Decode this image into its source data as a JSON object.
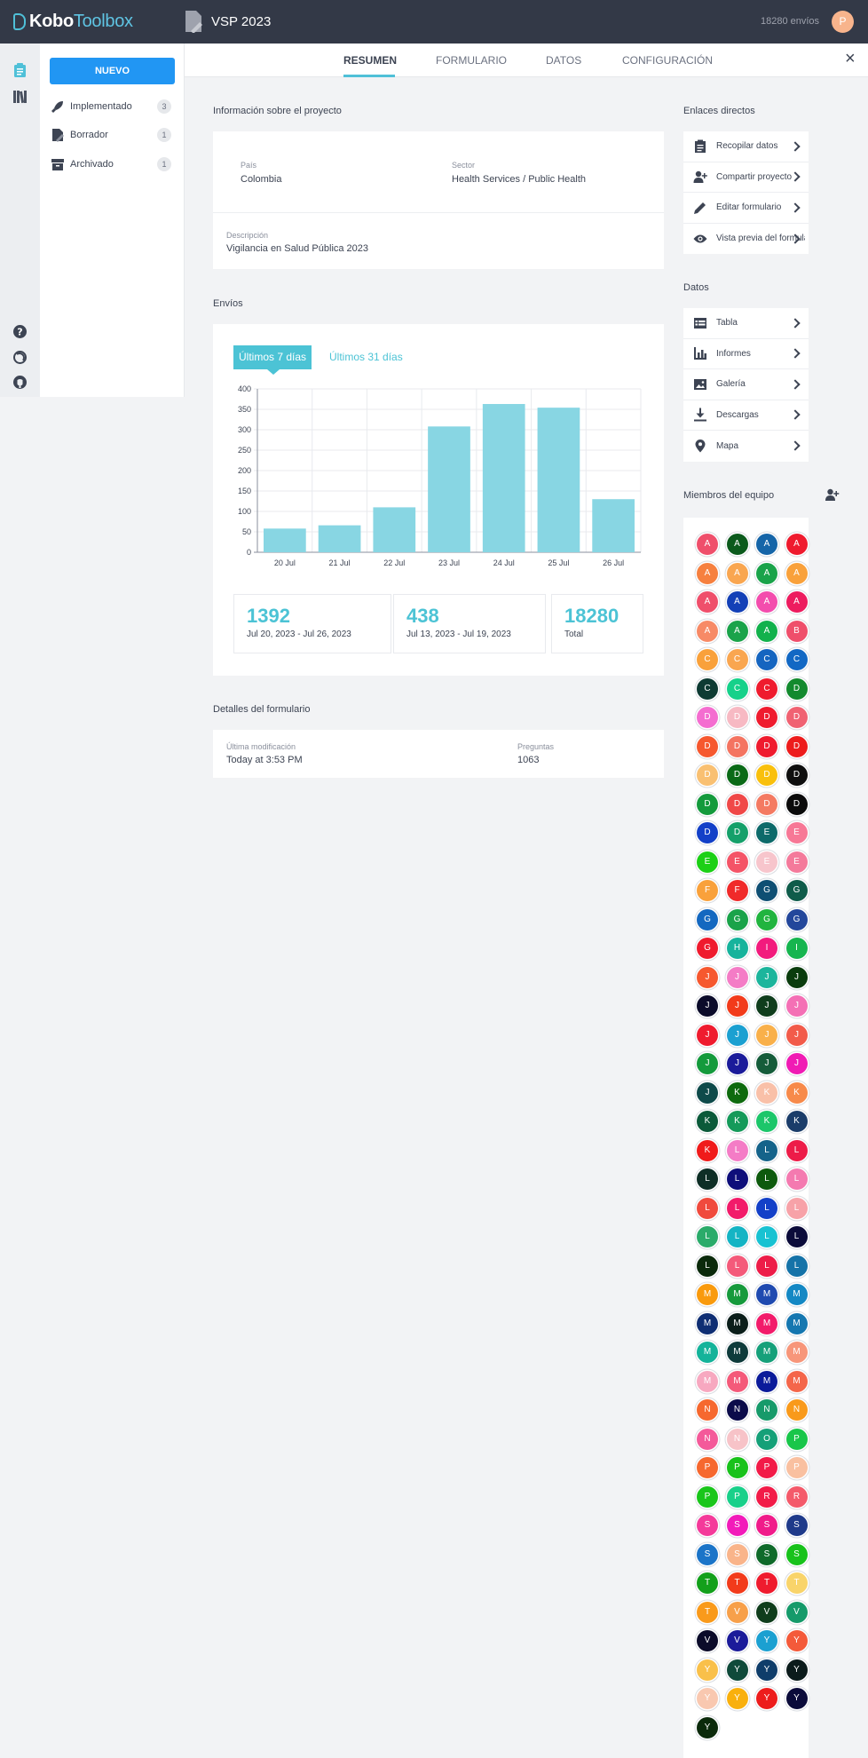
{
  "header": {
    "brand_kobo": "Kobo",
    "brand_toolbox": "Toolbox",
    "form_title": "VSP 2023",
    "submissions_count": "18280 envíos",
    "user_initial": "P"
  },
  "sidebar": {
    "new_button": "NUEVO",
    "items": [
      {
        "label": "Implementado",
        "count": "3",
        "icon": "rocket-icon"
      },
      {
        "label": "Borrador",
        "count": "1",
        "icon": "pencil-document-icon"
      },
      {
        "label": "Archivado",
        "count": "1",
        "icon": "archive-icon"
      }
    ]
  },
  "tabs": [
    "RESUMEN",
    "FORMULARIO",
    "DATOS",
    "CONFIGURACIÓN"
  ],
  "active_tab": "RESUMEN",
  "project_info": {
    "title": "Información sobre el proyecto",
    "country_label": "País",
    "country": "Colombia",
    "sector_label": "Sector",
    "sector": "Health Services / Public Health",
    "description_label": "Descripción",
    "description": "Vigilancia en Salud Pública 2023"
  },
  "submissions": {
    "title": "Envíos",
    "range_active": "Últimos 7 días",
    "range_other": "Últimos 31 días",
    "stats": [
      {
        "number": "1392",
        "caption": "Jul 20, 2023 - Jul 26, 2023"
      },
      {
        "number": "438",
        "caption": "Jul 13, 2023 - Jul 19, 2023"
      },
      {
        "number": "18280",
        "caption": "Total"
      }
    ]
  },
  "chart_data": {
    "type": "bar",
    "categories": [
      "20 Jul",
      "21 Jul",
      "22 Jul",
      "23 Jul",
      "24 Jul",
      "25 Jul",
      "26 Jul"
    ],
    "values": [
      58,
      66,
      110,
      308,
      363,
      354,
      130
    ],
    "yticks": [
      0,
      50,
      100,
      150,
      200,
      250,
      300,
      350,
      400
    ],
    "ylim": [
      0,
      400
    ],
    "grid": true,
    "color": "#88d6e3"
  },
  "form_details": {
    "title": "Detalles del formulario",
    "modified_label": "Última modificación",
    "modified": "Today at 3:53 PM",
    "questions_label": "Preguntas",
    "questions": "1063"
  },
  "direct_links": {
    "title": "Enlaces directos",
    "items": [
      {
        "label": "Recopilar datos",
        "icon": "clipboard-icon"
      },
      {
        "label": "Compartir proyecto",
        "icon": "add-user-icon"
      },
      {
        "label": "Editar formulario",
        "icon": "pencil-icon"
      },
      {
        "label": "Vista previa del formulario",
        "icon": "eye-icon"
      }
    ]
  },
  "data_links": {
    "title": "Datos",
    "items": [
      {
        "label": "Tabla",
        "icon": "table-icon"
      },
      {
        "label": "Informes",
        "icon": "bar-chart-icon"
      },
      {
        "label": "Galería",
        "icon": "image-icon"
      },
      {
        "label": "Descargas",
        "icon": "download-icon"
      },
      {
        "label": "Mapa",
        "icon": "map-pin-icon"
      }
    ]
  },
  "team": {
    "title": "Miembros del equipo",
    "members": [
      {
        "i": "A",
        "c": "#ef4f6b"
      },
      {
        "i": "A",
        "c": "#0b5a1c"
      },
      {
        "i": "A",
        "c": "#1565a8"
      },
      {
        "i": "A",
        "c": "#ef1b2e"
      },
      {
        "i": "A",
        "c": "#f6803f"
      },
      {
        "i": "A",
        "c": "#f9a650"
      },
      {
        "i": "A",
        "c": "#1aa34a"
      },
      {
        "i": "A",
        "c": "#f9a13b"
      },
      {
        "i": "A",
        "c": "#ef4f6b"
      },
      {
        "i": "A",
        "c": "#1340b7"
      },
      {
        "i": "A",
        "c": "#f34dad"
      },
      {
        "i": "A",
        "c": "#ed1c5f"
      },
      {
        "i": "A",
        "c": "#f78a66"
      },
      {
        "i": "A",
        "c": "#1aa34a"
      },
      {
        "i": "A",
        "c": "#12b14c"
      },
      {
        "i": "B",
        "c": "#ef4f6b"
      },
      {
        "i": "C",
        "c": "#f9a13b"
      },
      {
        "i": "C",
        "c": "#f9a650"
      },
      {
        "i": "C",
        "c": "#1565c0"
      },
      {
        "i": "C",
        "c": "#1268c4"
      },
      {
        "i": "C",
        "c": "#0e3b33"
      },
      {
        "i": "C",
        "c": "#16d18a"
      },
      {
        "i": "C",
        "c": "#ef1b2e"
      },
      {
        "i": "D",
        "c": "#138a2e"
      },
      {
        "i": "D",
        "c": "#f46dd0"
      },
      {
        "i": "D",
        "c": "#f7b9c3"
      },
      {
        "i": "D",
        "c": "#ef1b2e"
      },
      {
        "i": "D",
        "c": "#f06272"
      },
      {
        "i": "D",
        "c": "#f6582f"
      },
      {
        "i": "D",
        "c": "#f47461"
      },
      {
        "i": "D",
        "c": "#ef1b2e"
      },
      {
        "i": "D",
        "c": "#ed1c1c"
      },
      {
        "i": "D",
        "c": "#f9c072"
      },
      {
        "i": "D",
        "c": "#0a6a17"
      },
      {
        "i": "D",
        "c": "#f9c00d"
      },
      {
        "i": "D",
        "c": "#0f0f0f"
      },
      {
        "i": "D",
        "c": "#149a3c"
      },
      {
        "i": "D",
        "c": "#f04848"
      },
      {
        "i": "D",
        "c": "#f47a62"
      },
      {
        "i": "D",
        "c": "#0b0b0b"
      },
      {
        "i": "D",
        "c": "#1340c8"
      },
      {
        "i": "D",
        "c": "#15a06a"
      },
      {
        "i": "E",
        "c": "#0d6a6a"
      },
      {
        "i": "E",
        "c": "#f77896"
      },
      {
        "i": "E",
        "c": "#1cd016"
      },
      {
        "i": "E",
        "c": "#f45467"
      },
      {
        "i": "E",
        "c": "#f7c5cc"
      },
      {
        "i": "E",
        "c": "#f47a9b"
      },
      {
        "i": "F",
        "c": "#f9a13b"
      },
      {
        "i": "F",
        "c": "#f02a2a"
      },
      {
        "i": "G",
        "c": "#0f4f73"
      },
      {
        "i": "G",
        "c": "#0f5c4a"
      },
      {
        "i": "G",
        "c": "#1468c0"
      },
      {
        "i": "G",
        "c": "#1aa34a"
      },
      {
        "i": "G",
        "c": "#21b43f"
      },
      {
        "i": "G",
        "c": "#23479b"
      },
      {
        "i": "G",
        "c": "#ef1b2e"
      },
      {
        "i": "H",
        "c": "#16b39c"
      },
      {
        "i": "I",
        "c": "#f21b7d"
      },
      {
        "i": "I",
        "c": "#16b54f"
      },
      {
        "i": "J",
        "c": "#f6582f"
      },
      {
        "i": "J",
        "c": "#f47cc6"
      },
      {
        "i": "J",
        "c": "#1cb59c"
      },
      {
        "i": "J",
        "c": "#0a3c0d"
      },
      {
        "i": "J",
        "c": "#0b0b2a"
      },
      {
        "i": "J",
        "c": "#f23b1b"
      },
      {
        "i": "J",
        "c": "#0f3d1c"
      },
      {
        "i": "J",
        "c": "#f470b5"
      },
      {
        "i": "J",
        "c": "#ef1b2e"
      },
      {
        "i": "J",
        "c": "#1ba0d1"
      },
      {
        "i": "J",
        "c": "#f9b04a"
      },
      {
        "i": "J",
        "c": "#f25b4a"
      },
      {
        "i": "J",
        "c": "#149a3c"
      },
      {
        "i": "J",
        "c": "#1b1b9a"
      },
      {
        "i": "J",
        "c": "#155c3a"
      },
      {
        "i": "J",
        "c": "#f01bb4"
      },
      {
        "i": "J",
        "c": "#0e4a4a"
      },
      {
        "i": "K",
        "c": "#0e6a0e"
      },
      {
        "i": "K",
        "c": "#f9c0a8"
      },
      {
        "i": "K",
        "c": "#f78a4a"
      },
      {
        "i": "K",
        "c": "#0b5a3a"
      },
      {
        "i": "K",
        "c": "#159a5a"
      },
      {
        "i": "K",
        "c": "#1cc66a"
      },
      {
        "i": "K",
        "c": "#1b3d6a"
      },
      {
        "i": "K",
        "c": "#f01b1b"
      },
      {
        "i": "L",
        "c": "#f47cc6"
      },
      {
        "i": "L",
        "c": "#15638a"
      },
      {
        "i": "L",
        "c": "#ed1c48"
      },
      {
        "i": "L",
        "c": "#0e2e26"
      },
      {
        "i": "L",
        "c": "#0e0e7a"
      },
      {
        "i": "L",
        "c": "#0d5a0d"
      },
      {
        "i": "L",
        "c": "#f47ab0"
      },
      {
        "i": "L",
        "c": "#f04a3d"
      },
      {
        "i": "L",
        "c": "#f21b6a"
      },
      {
        "i": "L",
        "c": "#1340c8"
      },
      {
        "i": "L",
        "c": "#f7a2a8"
      },
      {
        "i": "L",
        "c": "#2aab6a"
      },
      {
        "i": "L",
        "c": "#14b4c4"
      },
      {
        "i": "L",
        "c": "#18c2d2"
      },
      {
        "i": "L",
        "c": "#0b0b3a"
      },
      {
        "i": "L",
        "c": "#0b2a0b"
      },
      {
        "i": "L",
        "c": "#f45a7a"
      },
      {
        "i": "L",
        "c": "#ed1c48"
      },
      {
        "i": "L",
        "c": "#1573a8"
      },
      {
        "i": "M",
        "c": "#f99a0d"
      },
      {
        "i": "M",
        "c": "#169a3c"
      },
      {
        "i": "M",
        "c": "#1f4ab0"
      },
      {
        "i": "M",
        "c": "#1488c4"
      },
      {
        "i": "M",
        "c": "#0f2e73"
      },
      {
        "i": "M",
        "c": "#0b1e1a"
      },
      {
        "i": "M",
        "c": "#f21b6a"
      },
      {
        "i": "M",
        "c": "#1577b0"
      },
      {
        "i": "M",
        "c": "#14b39a"
      },
      {
        "i": "M",
        "c": "#0e3b3b"
      },
      {
        "i": "M",
        "c": "#16a07a"
      },
      {
        "i": "M",
        "c": "#f7967a"
      },
      {
        "i": "M",
        "c": "#f7a8c0"
      },
      {
        "i": "M",
        "c": "#f45a7a"
      },
      {
        "i": "M",
        "c": "#0b1b9a"
      },
      {
        "i": "M",
        "c": "#f4664a"
      },
      {
        "i": "N",
        "c": "#f6682f"
      },
      {
        "i": "N",
        "c": "#0b0b4a"
      },
      {
        "i": "N",
        "c": "#179a6a"
      },
      {
        "i": "N",
        "c": "#f99a1b"
      },
      {
        "i": "N",
        "c": "#f45a9a"
      },
      {
        "i": "N",
        "c": "#f7c3c8"
      },
      {
        "i": "O",
        "c": "#15a078"
      },
      {
        "i": "P",
        "c": "#19c64a"
      },
      {
        "i": "P",
        "c": "#f6682f"
      },
      {
        "i": "P",
        "c": "#18c21b"
      },
      {
        "i": "P",
        "c": "#f21b48"
      },
      {
        "i": "P",
        "c": "#f9c0a0"
      },
      {
        "i": "P",
        "c": "#1ac61b"
      },
      {
        "i": "P",
        "c": "#19d08a"
      },
      {
        "i": "R",
        "c": "#f21b48"
      },
      {
        "i": "R",
        "c": "#f45a6a"
      },
      {
        "i": "S",
        "c": "#f43a9a"
      },
      {
        "i": "S",
        "c": "#f21bba"
      },
      {
        "i": "S",
        "c": "#f01b8a"
      },
      {
        "i": "S",
        "c": "#1f3a8a"
      },
      {
        "i": "S",
        "c": "#1b74c8"
      },
      {
        "i": "S",
        "c": "#f9b48a"
      },
      {
        "i": "S",
        "c": "#0f6a2a"
      },
      {
        "i": "S",
        "c": "#18c21b"
      },
      {
        "i": "T",
        "c": "#13a01b"
      },
      {
        "i": "T",
        "c": "#f23b1b"
      },
      {
        "i": "T",
        "c": "#ef1b2e"
      },
      {
        "i": "T",
        "c": "#f9d46a"
      },
      {
        "i": "T",
        "c": "#f99a1b"
      },
      {
        "i": "V",
        "c": "#f7a04a"
      },
      {
        "i": "V",
        "c": "#0f3d1c"
      },
      {
        "i": "V",
        "c": "#159a6a"
      },
      {
        "i": "V",
        "c": "#0b0b2a"
      },
      {
        "i": "V",
        "c": "#1b1b9a"
      },
      {
        "i": "Y",
        "c": "#1ba0d1"
      },
      {
        "i": "Y",
        "c": "#f45a3a"
      },
      {
        "i": "Y",
        "c": "#f9c04a"
      },
      {
        "i": "Y",
        "c": "#0f4a3a"
      },
      {
        "i": "Y",
        "c": "#0f3d6a"
      },
      {
        "i": "Y",
        "c": "#0b1b1b"
      },
      {
        "i": "Y",
        "c": "#f9c8b0"
      },
      {
        "i": "Y",
        "c": "#f9b00d"
      },
      {
        "i": "Y",
        "c": "#ed1c1c"
      },
      {
        "i": "Y",
        "c": "#0b0b3a"
      },
      {
        "i": "Y",
        "c": "#0b2a0b"
      }
    ]
  }
}
